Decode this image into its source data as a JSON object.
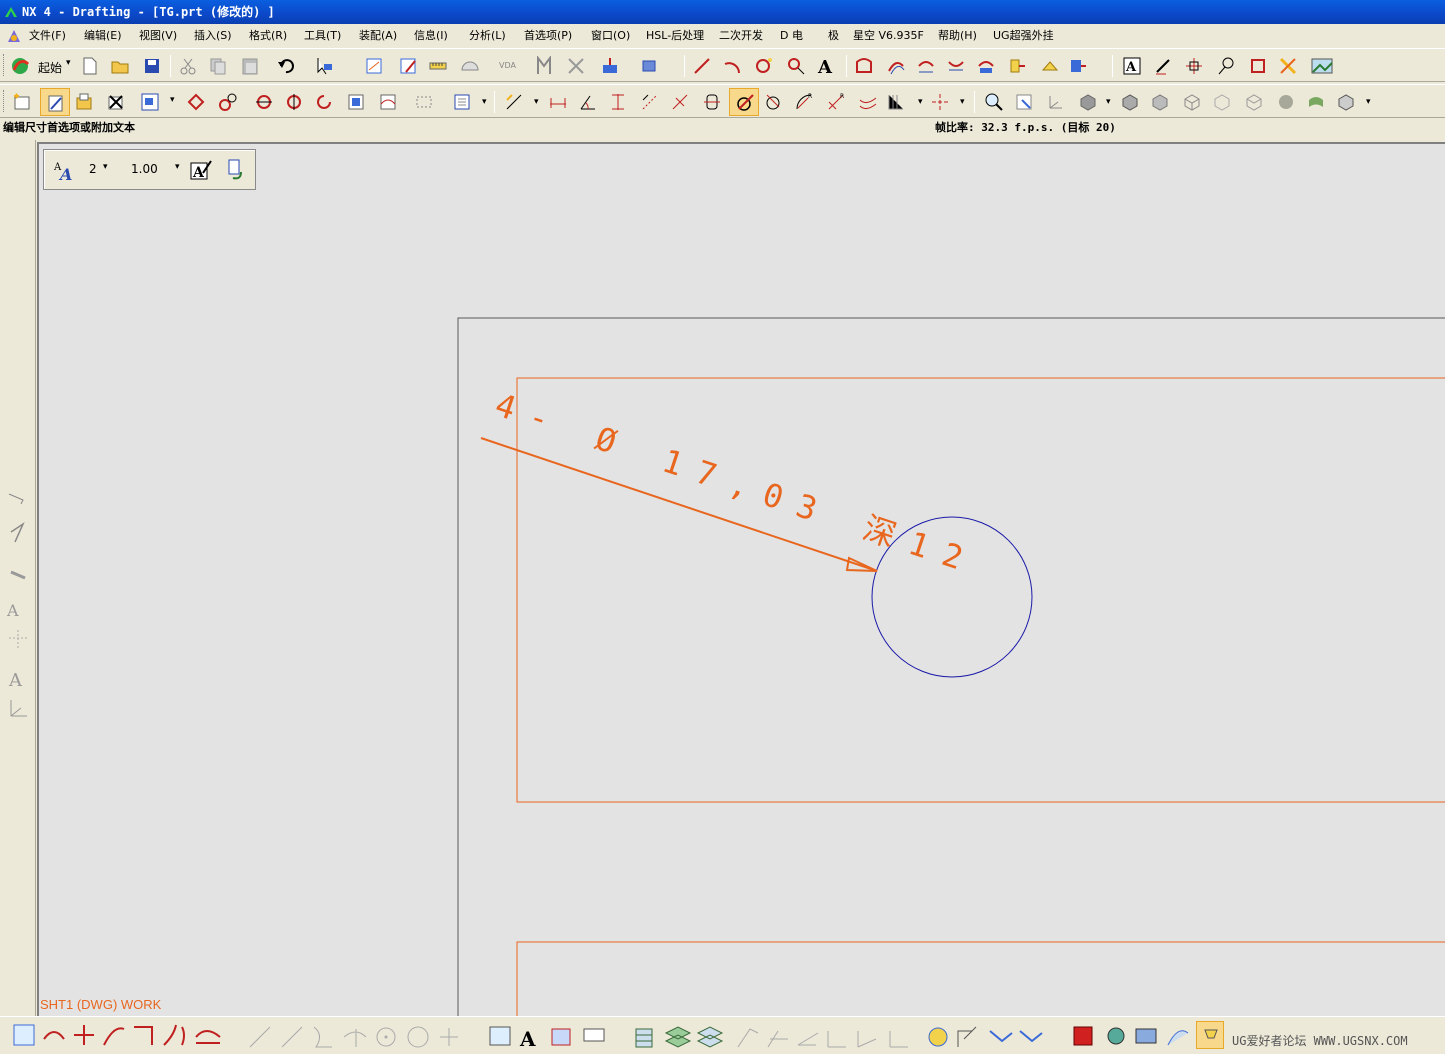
{
  "window": {
    "title": "NX 4 - Drafting - [TG.prt  (修改的) ]"
  },
  "menu": [
    "文件(F)",
    "编辑(E)",
    "视图(V)",
    "插入(S)",
    "格式(R)",
    "工具(T)",
    "装配(A)",
    "信息(I)",
    "分析(L)",
    "首选项(P)",
    "窗口(O)",
    "HSL-后处理",
    "二次开发",
    "D 电",
    "极",
    "星空 V6.935F",
    "帮助(H)",
    "UG超强外挂"
  ],
  "toolbar": {
    "start_label": "起始"
  },
  "status": {
    "prompt": "编辑尺寸首选项或附加文本",
    "frame_rate": "帧比率: 32.3 f.p.s. (目标 20)"
  },
  "floating_toolbar": {
    "text_size": "2",
    "scale": "1.00"
  },
  "annotation": {
    "text": "4- Ø 17,03 深12",
    "color": "#e8661e"
  },
  "sheet": {
    "label": "SHT1 (DWG) WORK"
  },
  "watermark": "UG爱好者论坛 WWW.UGSNX.COM",
  "colors": {
    "titlebar": "#0b48c8",
    "canvas": "#e3e3e3",
    "orange": "#e8661e",
    "circle": "#1a1aa8"
  }
}
